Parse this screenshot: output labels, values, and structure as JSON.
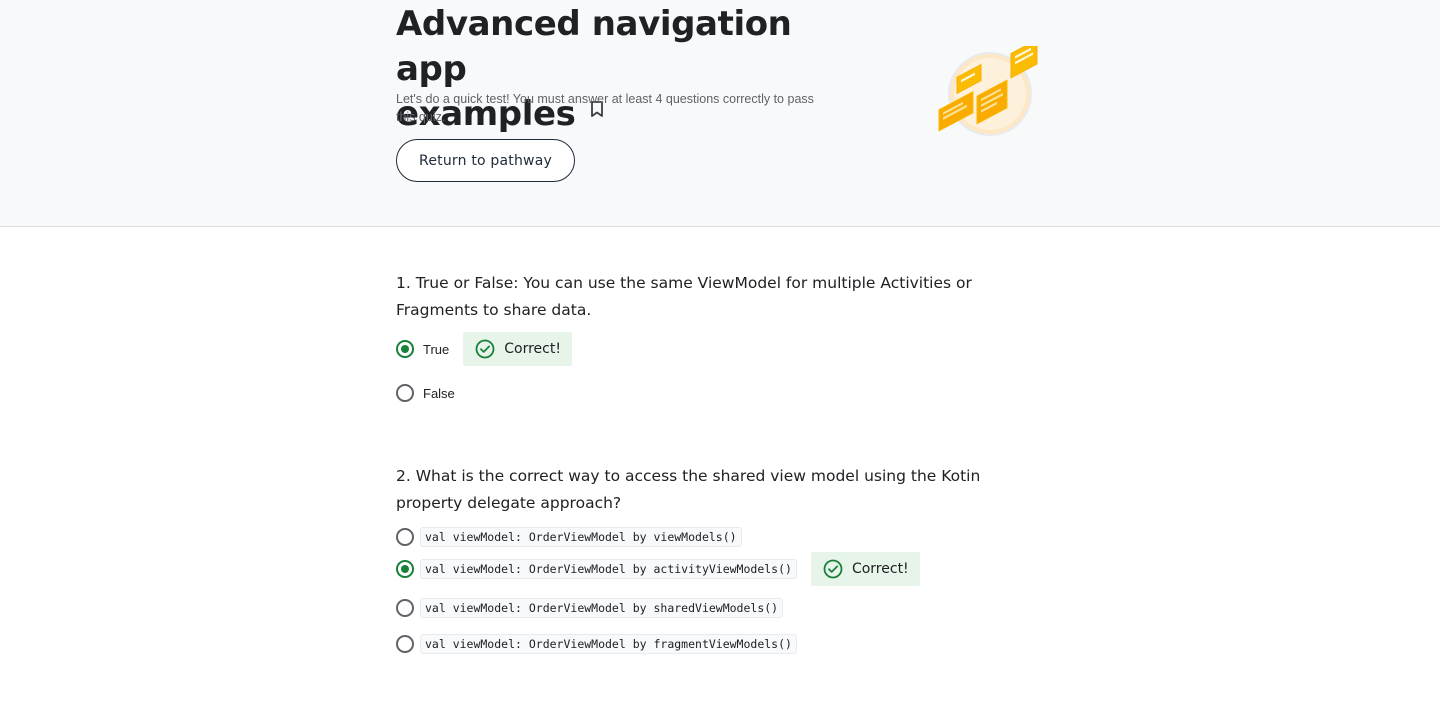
{
  "header": {
    "title_line1": "Advanced navigation app",
    "title_line2": "examples",
    "subtitle": "Let's do a quick test! You must answer at least 4 questions correctly to pass this quiz.",
    "return_button": "Return to pathway"
  },
  "colors": {
    "accent_green": "#188038",
    "correct_bg": "#e6f4ea",
    "hero_bg": "#f8f9fa",
    "illustration_orange": "#f9ab00"
  },
  "icons": {
    "bookmark": "bookmark-icon",
    "correct": "check-circle-icon",
    "illustration": "navigation-screens-illustration"
  },
  "questions": [
    {
      "text": "1. True or False: You can use the same ViewModel for multiple Activities or Fragments to share data.",
      "options": [
        {
          "label": "True",
          "selected": true,
          "feedback": "Correct!"
        },
        {
          "label": "False",
          "selected": false
        }
      ]
    },
    {
      "text": "2. What is the correct way to access the shared view model using the Kotin property delegate approach?",
      "options": [
        {
          "label": "val viewModel: OrderViewModel by viewModels()",
          "selected": false
        },
        {
          "label": "val viewModel: OrderViewModel by activityViewModels()",
          "selected": true,
          "feedback": "Correct!"
        },
        {
          "label": "val viewModel: OrderViewModel by sharedViewModels()",
          "selected": false
        },
        {
          "label": "val viewModel: OrderViewModel by fragmentViewModels()",
          "selected": false
        }
      ]
    }
  ]
}
